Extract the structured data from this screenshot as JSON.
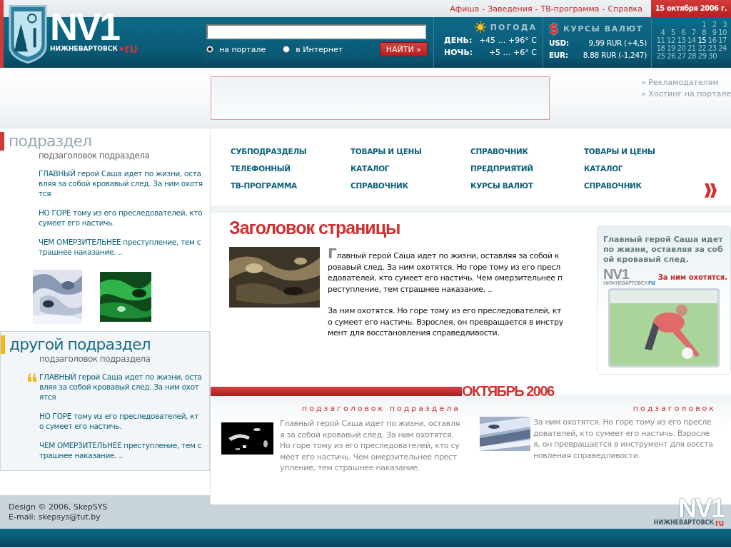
{
  "header": {
    "logo": {
      "wordmark": "NV1",
      "city": "НИЖНЕВАРТОВСК",
      "domain": "ru"
    },
    "top_links": [
      "Афиша",
      "Заведения",
      "ТВ-программа",
      "Справка"
    ],
    "separator": "-",
    "date": "15 октября 2006 г."
  },
  "search": {
    "options": [
      {
        "label": "на портале",
        "selected": true
      },
      {
        "label": "в Интернет",
        "selected": false
      }
    ],
    "button": "НАЙТИ »"
  },
  "weather": {
    "title": "ПОГОДА",
    "rows": [
      {
        "label": "ДЕНЬ:",
        "value": "+45 … +96° C"
      },
      {
        "label": "НОЧЬ:",
        "value": "+5 … +6° C"
      }
    ]
  },
  "currency": {
    "symbol": "$",
    "title": "КУРСЫ ВАЛЮТ",
    "rows": [
      {
        "label": "USD:",
        "value": "9,99 RUR (+4,5)"
      },
      {
        "label": "EUR:",
        "value": "8.88 RUR (-1,247)"
      }
    ]
  },
  "calendar": {
    "weeks": [
      [
        {
          "day": "1",
          "selected": false
        },
        {
          "day": "2",
          "selected": false
        },
        {
          "day": "3",
          "selected": false
        }
      ],
      [
        {
          "day": "4",
          "selected": false
        },
        {
          "day": "5",
          "selected": false
        },
        {
          "day": "6",
          "selected": false
        },
        {
          "day": "7",
          "selected": false
        },
        {
          "day": "8",
          "selected": false
        },
        {
          "day": "9",
          "selected": false
        },
        {
          "day": "10",
          "selected": false
        }
      ],
      [
        {
          "day": "11",
          "selected": false
        },
        {
          "day": "12",
          "selected": false
        },
        {
          "day": "13",
          "selected": false
        },
        {
          "day": "14",
          "selected": false
        },
        {
          "day": "15",
          "selected": true
        },
        {
          "day": "16",
          "selected": false
        },
        {
          "day": "17",
          "selected": false
        }
      ],
      [
        {
          "day": "18",
          "selected": false
        },
        {
          "day": "19",
          "selected": false
        },
        {
          "day": "20",
          "selected": false
        },
        {
          "day": "21",
          "selected": false
        },
        {
          "day": "22",
          "selected": false
        },
        {
          "day": "23",
          "selected": false
        },
        {
          "day": "24",
          "selected": false
        }
      ],
      [
        {
          "day": "25",
          "selected": false
        },
        {
          "day": "26",
          "selected": false
        },
        {
          "day": "27",
          "selected": false
        },
        {
          "day": "28",
          "selected": false
        },
        {
          "day": "29",
          "selected": false
        },
        {
          "day": "30",
          "selected": false
        }
      ]
    ]
  },
  "ad": {
    "links": [
      "» Рекламодателям",
      "» Хостинг на портале"
    ]
  },
  "sidebar": {
    "sections": [
      {
        "title": "подраздел",
        "subtitle": "подзаголовок подраздела",
        "color": "#d03a3a",
        "boxed": false,
        "quote": false,
        "paragraphs": [
          "ГЛАВНЫЙ герой Саша идет по жизни, оставляя за собой кровавый след. За ним охотятся",
          "НО ГОРЕ тому из его преследователей, кто сумеет его настичь.",
          "ЧЕМ ОМЕРЗИТЕЛЬНЕЕ преступление, тем страшнее наказание. .."
        ],
        "pictures": [
          {
            "kind": "picture"
          },
          {
            "kind": "picture"
          }
        ]
      },
      {
        "title": "другой подраздел",
        "subtitle": "подзаголовок подраздела",
        "color": "#f2b820",
        "boxed": true,
        "quote": true,
        "paragraphs": [
          "ГЛАВНЫЙ герой Саша идет по жизни, оставляя за собой кровавый след. За ним охотятся",
          "НО ГОРЕ тому из его преследователей, кто сумеет его настичь.",
          "ЧЕМ ОМЕРЗИТЕЛЬНЕЕ преступление, тем страшнее наказание. .."
        ]
      }
    ]
  },
  "nav": {
    "columns": [
      [
        "СУБПОДРАЗДЕЛЫ",
        "ТЕЛЕФОННЫЙ",
        "ТВ-ПРОГРАММА"
      ],
      [
        "ТОВАРЫ И ЦЕНЫ",
        "КАТАЛОГ",
        "СПРАВОЧНИК"
      ],
      [
        "СПРАВОЧНИК",
        "ПРЕДПРИЯТИЙ",
        "КУРСЫ ВАЛЮТ"
      ],
      [
        "ТОВАРЫ И ЦЕНЫ",
        "КАТАЛОГ",
        "СПРАВОЧНИК"
      ]
    ]
  },
  "article": {
    "title": "Заголовок страницы",
    "paragraphs": [
      "Главный герой Саша идет по жизни, оставляя за собой кровавый след. За ним охотятся. Но горе тому из его преследователей, кто сумеет его настичь. Чем омерзительнее преступление, тем страшнее наказание. ..",
      "За ним охотятся. Но горе тому из его преследователей, кто сумеет его настичь. Взрослея, он превращается в инструмент для восстановления справедливости."
    ]
  },
  "side_card": {
    "text": "Главный герой Саша идет по жизни, оставляя за собой кровавый след.",
    "logo": {
      "wordmark": "NV1",
      "city": "НИЖНЕВАРТОВСК",
      "domain": "ru"
    },
    "caption": "За ним охотятся."
  },
  "month": {
    "title": "ОКТЯБРЬ 2006",
    "news": [
      {
        "title": "подзаголовок подраздела",
        "text": "Главный герой Саша идет по жизни, оставляя за собой кровавый след. За ним охотятся. Но горе тому из его преследователей, кто сумеет его настичь. Чем омерзительнее преступление, тем страшнее наказание."
      },
      {
        "title": "подзаголовок",
        "text": "За ним охотятся. Но горе тому из его преследователей, кто сумеет его настичь. Взрослея, он превращается в инструмент для восстановления справедливости."
      }
    ]
  },
  "footer": {
    "lines": [
      "Design © 2006, SkepSYS",
      "E-mail: skepsys@tut.by"
    ],
    "logo": {
      "wordmark": "NV1",
      "city": "НИЖНЕВАРТОВСК",
      "domain": "ru"
    }
  }
}
